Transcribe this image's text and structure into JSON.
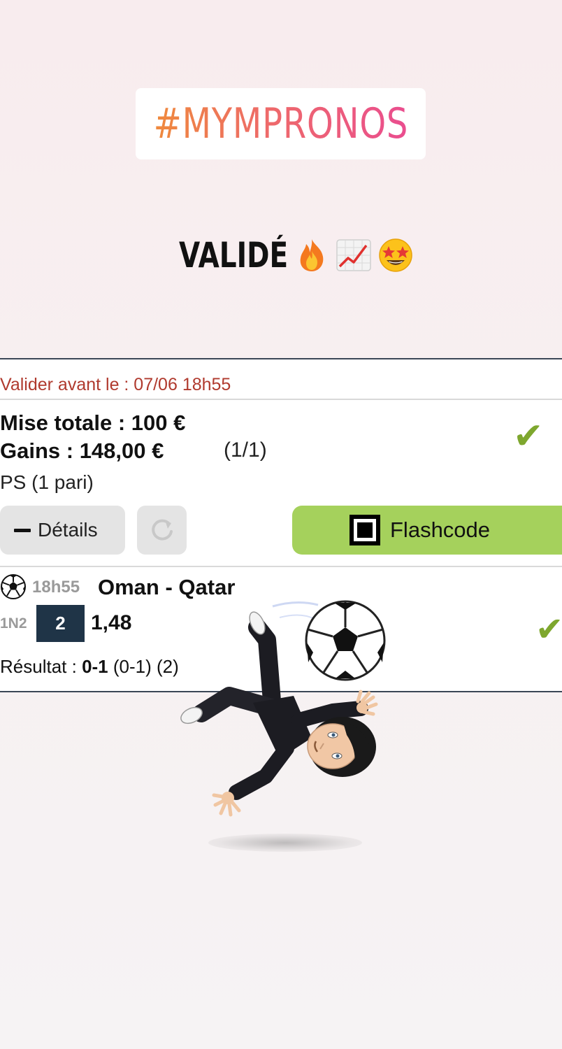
{
  "story": {
    "hashtag": "#MYMPRONOS",
    "caption": "VALIDÉ",
    "caption_emojis": [
      "fire-emoji",
      "chart-increasing-emoji",
      "star-struck-emoji"
    ]
  },
  "bet_slip": {
    "deadline": "Valider avant le : 07/06 18h55",
    "stake": "Mise totale : 100 €",
    "winnings": "Gains : 148,00 €",
    "fraction": "(1/1)",
    "bet_kind": "PS (1 pari)",
    "status_icon": "check-icon",
    "details_button": "Détails",
    "flashcode_button": "Flashcode",
    "colors": {
      "accent_green": "#a5d15c",
      "check_green": "#7ea72e",
      "deadline_red": "#b03a2e",
      "pick_navy": "#1f3447"
    }
  },
  "match": {
    "sport_icon": "soccer-ball-icon",
    "time": "18h55",
    "teams": "Oman - Qatar",
    "bet_type": "1N2",
    "pick": "2",
    "odds": "1,48",
    "result_label": "Résultat :",
    "result_score": "0-1",
    "result_detail": "(0-1) (2)"
  },
  "sticker": {
    "name": "bitmoji-bicycle-kick-sticker"
  }
}
